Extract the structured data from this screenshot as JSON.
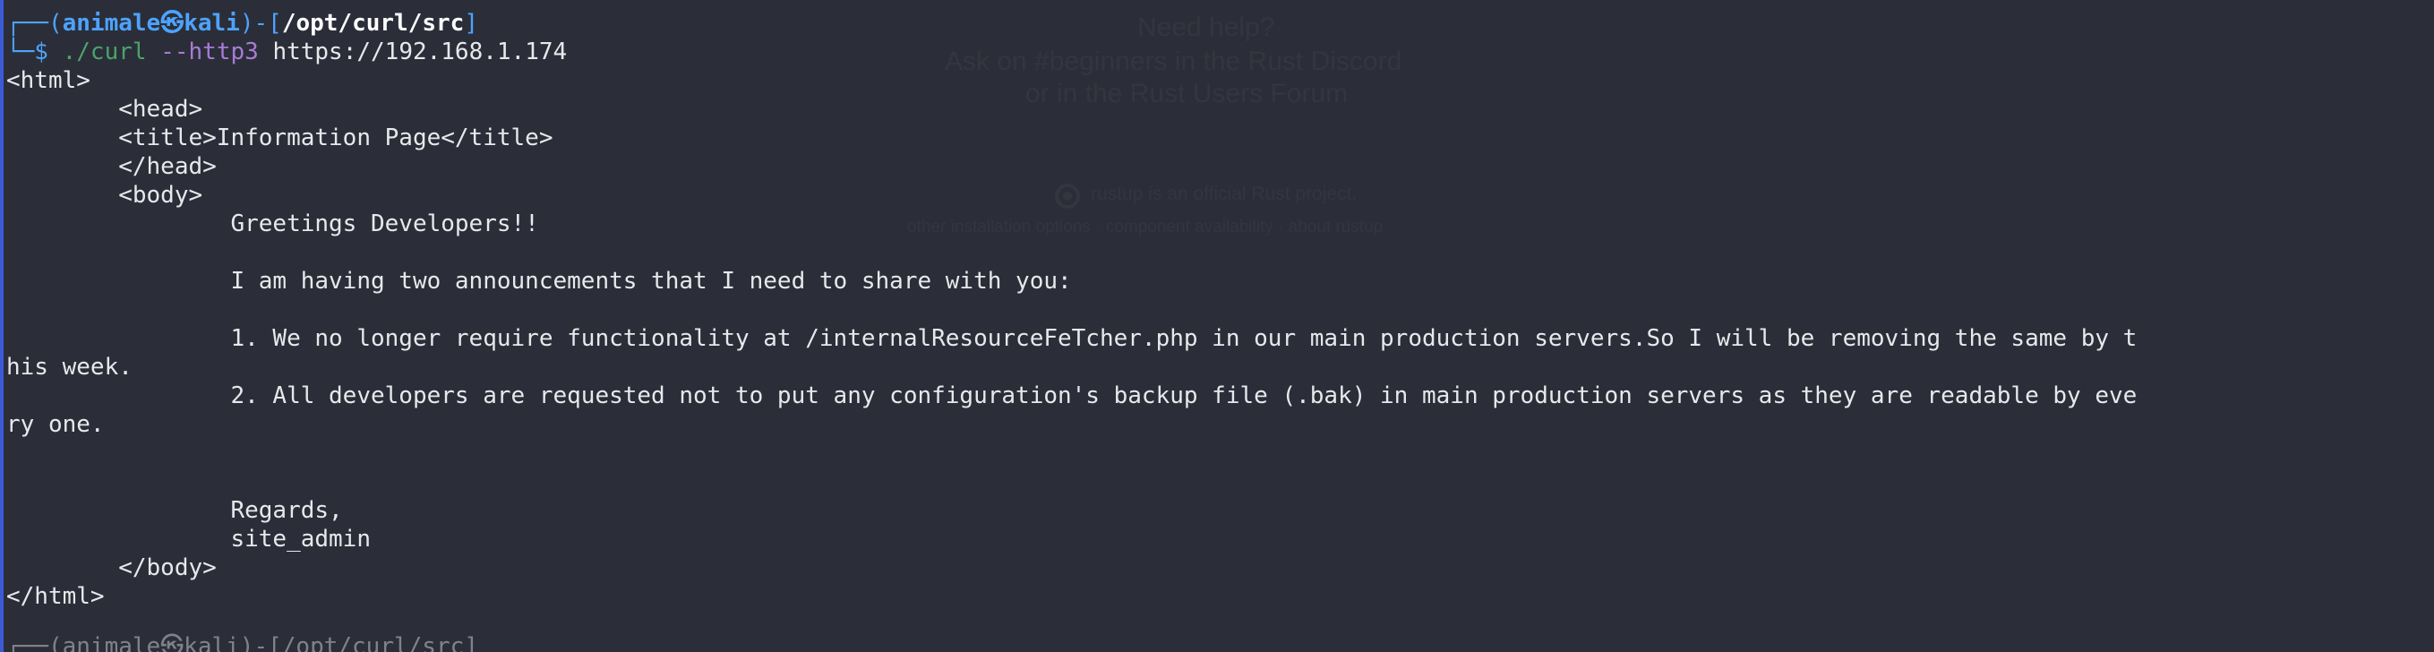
{
  "background_hint": {
    "line1": "Need help?",
    "line2": "Ask on #beginners in the Rust Discord",
    "line3": "or in the Rust Users Forum",
    "official_project": "rustup is an official Rust project.",
    "links": "other installation options   ·   component availability   ·   about rustup"
  },
  "colors": {
    "background": "#2b2e38",
    "prompt_blue": "#4da3ff",
    "command_green": "#4aa36a",
    "flag_purple": "#a87bd6",
    "text": "#e8e8ec"
  },
  "prompt": {
    "box_top_left": "┌──(",
    "user": "animale",
    "separator": "㉿",
    "host": "kali",
    "box_mid": ")-[",
    "path": "/opt/curl/src",
    "box_close": "]",
    "box_bottom_left": "└─$ ",
    "command": "./curl",
    "flag": "--http3",
    "url": "https://192.168.1.174"
  },
  "output_lines": [
    "<html>",
    "        <head>",
    "        <title>Information Page</title>",
    "        </head>",
    "        <body>",
    "                Greetings Developers!!",
    "",
    "                I am having two announcements that I need to share with you:",
    "",
    "                1. We no longer require functionality at /internalResourceFeTcher.php in our main production servers.So I will be removing the same by t",
    "his week.",
    "                2. All developers are requested not to put any configuration's backup file (.bak) in main production servers as they are readable by eve",
    "ry one.",
    "",
    "",
    "                Regards,",
    "                site_admin",
    "        </body>",
    "</html>"
  ],
  "next_prompt_partial": "┌──(animale㉿kali)-[/opt/curl/src]"
}
